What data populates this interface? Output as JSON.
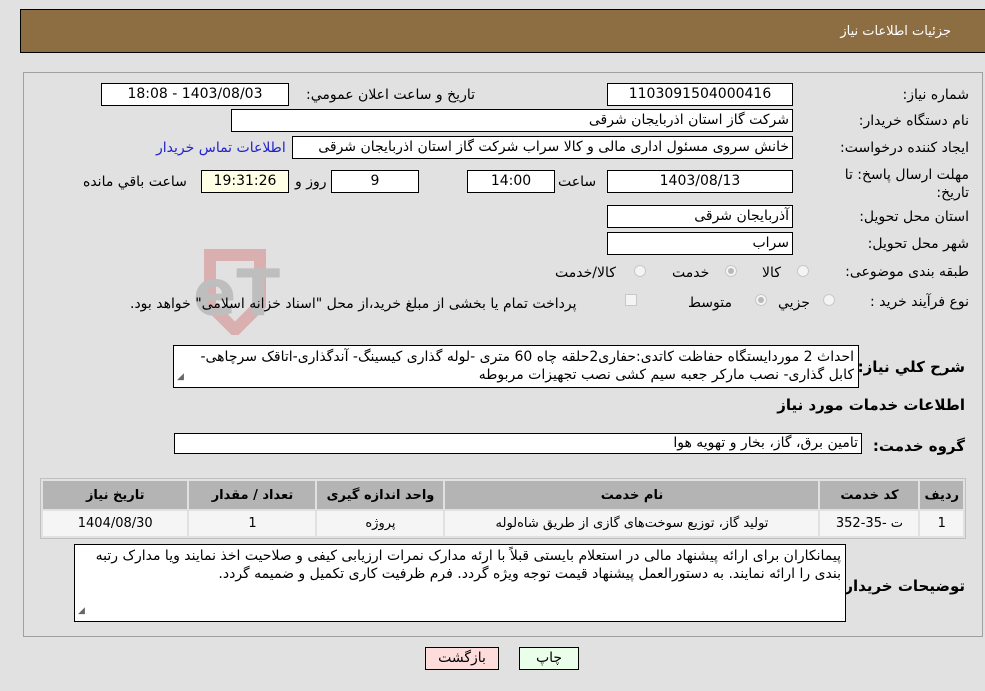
{
  "header": {
    "title": "جزئیات اطلاعات نیاز"
  },
  "form": {
    "need_number": {
      "label": "شماره نیاز:",
      "value": "1103091504000416"
    },
    "announce_datetime": {
      "label": "تاريخ و ساعت اعلان عمومي:",
      "value": "1403/08/03 - 18:08"
    },
    "buyer_org": {
      "label": "نام دستگاه خريدار:",
      "value": "شرکت گاز استان اذربایجان شرقی"
    },
    "requester": {
      "label": "ايجاد کننده درخواست:",
      "value": "خانش سروی مسئول اداری مالی و کالا سراب شرکت گاز استان اذربایجان شرقی",
      "contact_link": "اطلاعات تماس خريدار"
    },
    "deadline": {
      "label": "مهلت ارسال پاسخ: تا تاريخ:",
      "date": "1403/08/13",
      "time_label": "ساعت",
      "time": "14:00",
      "days": "9",
      "days_label": "روز و",
      "remaining": "19:31:26",
      "remaining_label": "ساعت باقي مانده"
    },
    "delivery_province": {
      "label": "استان محل تحويل:",
      "value": "آذربایجان شرقی"
    },
    "delivery_city": {
      "label": "شهر محل تحويل:",
      "value": "سراب"
    },
    "category": {
      "label": "طبقه بندی موضوعی:",
      "options": [
        {
          "label": "کالا",
          "checked": false
        },
        {
          "label": "خدمت",
          "checked": true
        },
        {
          "label": "کالا/خدمت",
          "checked": false
        }
      ]
    },
    "purchase_type": {
      "label": "نوع فرآيند خريد :",
      "options": [
        {
          "label": "جزيي",
          "checked": false
        },
        {
          "label": "متوسط",
          "checked": true
        }
      ],
      "treasury_checkbox_label": "پرداخت تمام يا بخشی از مبلغ خريد،از محل \"اسناد خزانه اسلامی\" خواهد بود.",
      "treasury_checked": false
    },
    "description": {
      "label": "شرح کلي نياز:",
      "value": "احداث 2 موردایستگاه حفاظت کاتدی:حفاری2حلقه چاه 60 متری -لوله گذاری کیسینگ- آندگذاری-اتاقک سرچاهی-کابل گذاری- نصب مارکر جعبه سیم کشی نصب تجهیزات مربوطه"
    }
  },
  "services": {
    "section_title": "اطلاعات خدمات مورد نياز",
    "group_label": "گروه خدمت:",
    "group_value": "تامین برق، گاز، بخار و تهویه هوا",
    "table": {
      "headers": [
        "رديف",
        "کد خدمت",
        "نام خدمت",
        "واحد اندازه گيری",
        "تعداد / مقدار",
        "تاريخ نياز"
      ],
      "rows": [
        [
          "1",
          "ت -35-352",
          "تولید گاز، توزیع سوخت‌های گازی از طریق شاه‌لوله",
          "پروژه",
          "1",
          "1404/08/30"
        ]
      ]
    }
  },
  "buyer_notes": {
    "label": "توضيحات خريدار:",
    "value": "پیمانکاران برای ارائه پیشنهاد مالی در استعلام بایستی قبلاً با ارئه مدارک نمرات ارزیابی کیفی و صلاحیت اخذ نمایند ویا مدارک رتبه بندی را ارائه نمایند. به دستورالعمل پیشنهاد قیمت توجه ویژه گردد. فرم ظرفیت کاری تکمیل و ضمیمه گردد."
  },
  "buttons": {
    "print": "چاپ",
    "back": "بازگشت"
  },
  "colors": {
    "header_bg": "#8d6e43",
    "print_bg": "#eaffea",
    "back_bg": "#ffdcdc",
    "link": "#2222cc"
  },
  "watermark": {
    "text": "AriaTender.neT"
  }
}
